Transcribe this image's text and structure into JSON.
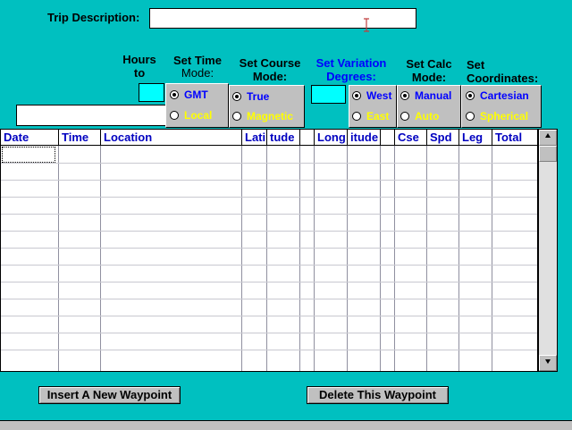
{
  "trip": {
    "label": "Trip Description:",
    "value": ""
  },
  "hours": {
    "label_line1": "Hours",
    "label_line2": "to",
    "value": "",
    "long_field_value": ""
  },
  "time_mode": {
    "label_line1": "Set Time",
    "label_line2": "Mode:",
    "options": [
      {
        "label": "GMT",
        "selected": true
      },
      {
        "label": "Local",
        "selected": false
      }
    ]
  },
  "course_mode": {
    "label_line1": "Set Course",
    "label_line2": "Mode:",
    "options": [
      {
        "label": "True",
        "selected": true
      },
      {
        "label": "Magnetic",
        "selected": false
      }
    ]
  },
  "variation": {
    "label_line1": "Set Variation",
    "label_line2": "Degrees:",
    "value": "",
    "options": [
      {
        "label": "West",
        "selected": true
      },
      {
        "label": "East",
        "selected": false
      }
    ]
  },
  "calc_mode": {
    "label_line1": "Set Calc",
    "label_line2": "Mode:",
    "options": [
      {
        "label": "Manual",
        "selected": true
      },
      {
        "label": "Auto",
        "selected": false
      }
    ]
  },
  "coordinates": {
    "label_line1": "Set",
    "label_line2": "Coordinates:",
    "options": [
      {
        "label": "Cartesian",
        "selected": true
      },
      {
        "label": "Spherical",
        "selected": false
      }
    ]
  },
  "grid": {
    "columns": [
      "Date",
      "Time",
      "Location",
      "Lati",
      "tude",
      "",
      "Long",
      "itude",
      "",
      "Cse",
      "Spd",
      "Leg",
      "Total"
    ],
    "rows": []
  },
  "scrollbar": {
    "up_icon": "arrow-up-icon",
    "down_icon": "arrow-down-icon"
  },
  "buttons": {
    "insert": "Insert A New Waypoint",
    "delete": "Delete This Waypoint"
  }
}
